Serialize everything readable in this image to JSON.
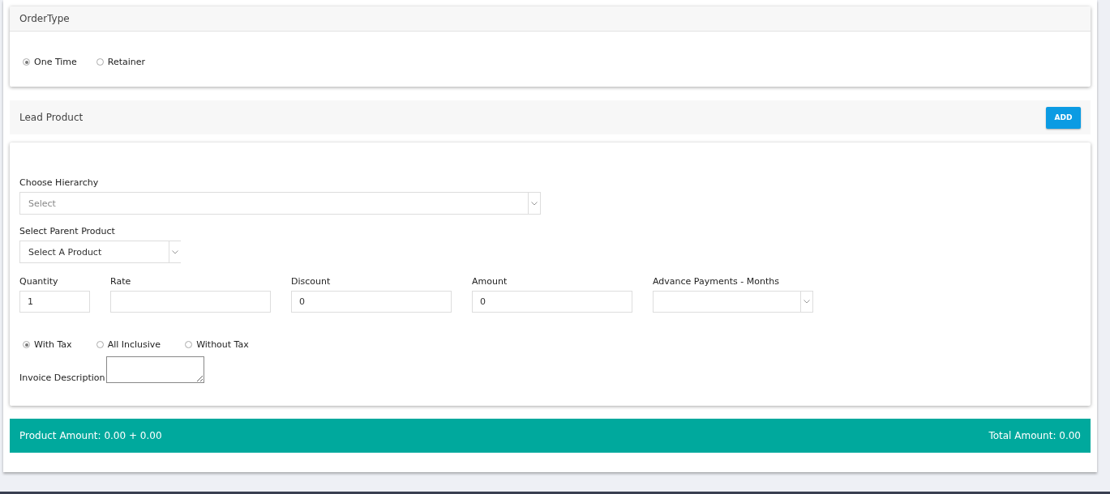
{
  "order_type": {
    "title": "OrderType",
    "options": [
      {
        "label": "One Time",
        "selected": true
      },
      {
        "label": "Retainer",
        "selected": false
      }
    ]
  },
  "lead_product": {
    "title": "Lead Product",
    "add_button": "ADD"
  },
  "form": {
    "hierarchy": {
      "label": "Choose Hierarchy",
      "placeholder": "Select"
    },
    "parent_product": {
      "label": "Select Parent Product",
      "value": "Select A Product"
    },
    "fields": [
      {
        "label": "Quantity",
        "value": "1",
        "kind": "input"
      },
      {
        "label": "Rate",
        "kind": "input"
      },
      {
        "label": "Discount",
        "value": "0",
        "kind": "input"
      },
      {
        "label": "Amount",
        "value": "0",
        "kind": "input"
      },
      {
        "label": "Advance Payments - Months",
        "kind": "select"
      }
    ],
    "tax_options": [
      {
        "label": "With Tax",
        "selected": true
      },
      {
        "label": "All Inclusive",
        "selected": false
      },
      {
        "label": "Without Tax",
        "selected": false
      }
    ],
    "invoice_description": {
      "label": "Invoice Description"
    }
  },
  "summary": {
    "product_amount": "Product Amount: 0.00 + 0.00",
    "total_amount": "Total Amount: 0.00"
  }
}
